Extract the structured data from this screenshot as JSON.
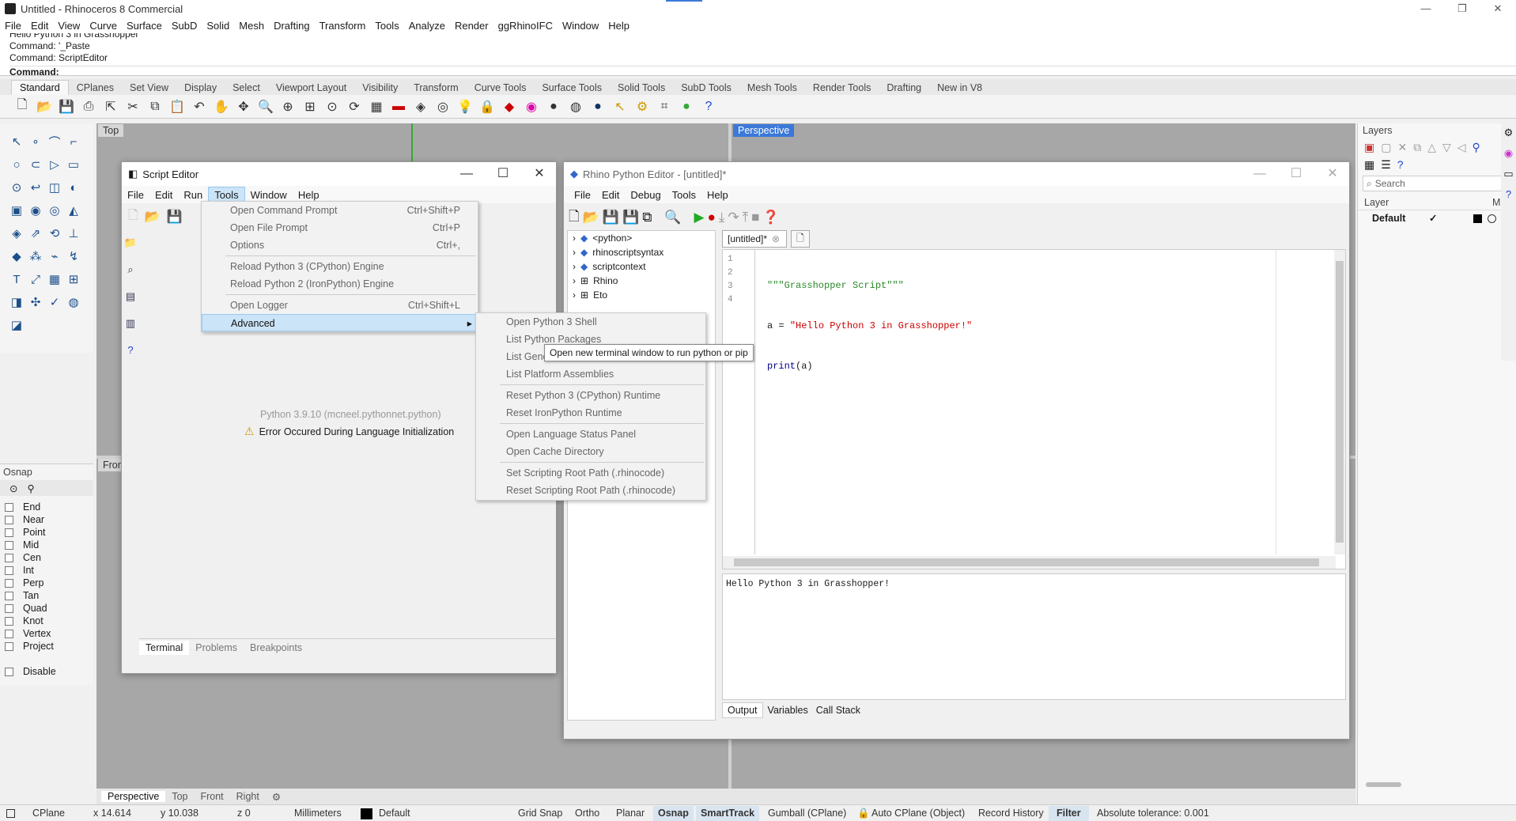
{
  "titlebar": {
    "title": "Untitled - Rhinoceros 8 Commercial",
    "min": "—",
    "max": "❐",
    "close": "✕"
  },
  "menubar": [
    "File",
    "Edit",
    "View",
    "Curve",
    "Surface",
    "SubD",
    "Solid",
    "Mesh",
    "Drafting",
    "Transform",
    "Tools",
    "Analyze",
    "Render",
    "ggRhinoIFC",
    "Window",
    "Help"
  ],
  "command": {
    "history": [
      "Hello Python 3 in Grasshopper",
      "Command: '_Paste",
      "Command: ScriptEditor"
    ],
    "prompt": "Command:"
  },
  "ribbon_tabs": [
    "Standard",
    "CPlanes",
    "Set View",
    "Display",
    "Select",
    "Viewport Layout",
    "Visibility",
    "Transform",
    "Curve Tools",
    "Surface Tools",
    "Solid Tools",
    "SubD Tools",
    "Mesh Tools",
    "Render Tools",
    "Drafting",
    "New in V8"
  ],
  "viewports": {
    "top": "Top",
    "perspective": "Perspective",
    "front": "Fron",
    "tabs": [
      "Perspective",
      "Top",
      "Front",
      "Right"
    ]
  },
  "osnap": {
    "title": "Osnap",
    "items": [
      "End",
      "Near",
      "Point",
      "Mid",
      "Cen",
      "Int",
      "Perp",
      "Tan",
      "Quad",
      "Knot",
      "Vertex",
      "Project"
    ],
    "disable": "Disable"
  },
  "script_editor": {
    "title": "Script Editor",
    "menu": [
      "File",
      "Edit",
      "Run",
      "Tools",
      "Window",
      "Help"
    ],
    "python_version": "Python 3.9.10 (mcneel.pythonnet.python)",
    "error": "Error Occured During Language Initialization",
    "bottom_tabs": [
      "Terminal",
      "Problems",
      "Breakpoints"
    ]
  },
  "tools_menu": [
    {
      "label": "Open Command Prompt",
      "shortcut": "Ctrl+Shift+P"
    },
    {
      "label": "Open File Prompt",
      "shortcut": "Ctrl+P"
    },
    {
      "label": "Options",
      "shortcut": "Ctrl+,"
    },
    {
      "label": "Reload Python 3 (CPython) Engine",
      "shortcut": ""
    },
    {
      "label": "Reload Python 2 (IronPython) Engine",
      "shortcut": ""
    },
    {
      "label": "Open Logger",
      "shortcut": "Ctrl+Shift+L"
    },
    {
      "label": "Advanced",
      "shortcut": "▸"
    }
  ],
  "advanced_menu": [
    "Open Python 3 Shell",
    "List Python Packages",
    "List General Assemblies",
    "List Platform Assemblies",
    "Reset Python 3 (CPython) Runtime",
    "Reset IronPython Runtime",
    "Open Language Status Panel",
    "Open Cache Directory",
    "Set Scripting Root Path (.rhinocode)",
    "Reset Scripting Root Path (.rhinocode)"
  ],
  "tooltip": "Open new terminal window to run python or pip",
  "python_editor": {
    "title": "Rhino Python Editor - [untitled]*",
    "menu": [
      "File",
      "Edit",
      "Debug",
      "Tools",
      "Help"
    ],
    "tree": [
      "<python>",
      "rhinoscriptsyntax",
      "scriptcontext",
      "Rhino",
      "Eto"
    ],
    "tab": "[untitled]*",
    "line_numbers": [
      "1",
      "2",
      "3",
      "4"
    ],
    "code": [
      "\"\"\"Grasshopper Script\"\"\"",
      "a = ",
      "\"Hello Python 3 in Grasshopper!\"",
      "print",
      "(a)"
    ],
    "output": "Hello Python 3 in Grasshopper!",
    "bottom_tabs": [
      "Output",
      "Variables",
      "Call Stack"
    ]
  },
  "layers": {
    "title": "Layers",
    "search": "Search",
    "col_layer": "Layer",
    "col_m": "M",
    "default": "Default",
    "check": "✓"
  },
  "status": {
    "cplane": "CPlane",
    "x": "x 14.614",
    "y": "y 10.038",
    "z": "z 0",
    "units": "Millimeters",
    "layer": "Default",
    "grid_snap": "Grid Snap",
    "ortho": "Ortho",
    "planar": "Planar",
    "osnap": "Osnap",
    "smarttrack": "SmartTrack",
    "gumball": "Gumball (CPlane)",
    "autocplane": "Auto CPlane (Object)",
    "record": "Record History",
    "filter": "Filter",
    "tolerance": "Absolute tolerance: 0.001"
  }
}
